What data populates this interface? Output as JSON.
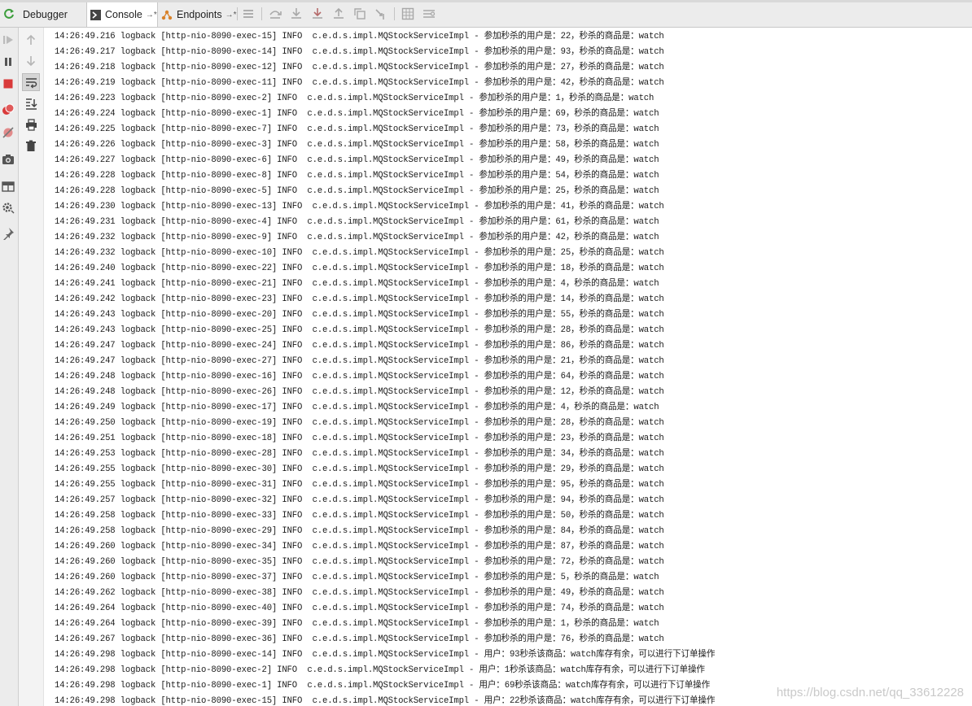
{
  "tabs": [
    {
      "label": "Debugger",
      "active": false
    },
    {
      "label": "Console",
      "active": true
    },
    {
      "label": "Endpoints",
      "active": false
    }
  ],
  "pin_glyph": "→*",
  "colors": {
    "accent_green": "#3c9e3c",
    "stop_red": "#d93a3a",
    "endpoints_orange": "#d9822b"
  },
  "console_lines": [
    "14:26:49.216 logback [http-nio-8090-exec-15] INFO  c.e.d.s.impl.MQStockServiceImpl - 参加秒杀的用户是：22，秒杀的商品是：watch",
    "14:26:49.217 logback [http-nio-8090-exec-14] INFO  c.e.d.s.impl.MQStockServiceImpl - 参加秒杀的用户是：93，秒杀的商品是：watch",
    "14:26:49.218 logback [http-nio-8090-exec-12] INFO  c.e.d.s.impl.MQStockServiceImpl - 参加秒杀的用户是：27，秒杀的商品是：watch",
    "14:26:49.219 logback [http-nio-8090-exec-11] INFO  c.e.d.s.impl.MQStockServiceImpl - 参加秒杀的用户是：42，秒杀的商品是：watch",
    "14:26:49.223 logback [http-nio-8090-exec-2] INFO  c.e.d.s.impl.MQStockServiceImpl - 参加秒杀的用户是：1，秒杀的商品是：watch",
    "14:26:49.224 logback [http-nio-8090-exec-1] INFO  c.e.d.s.impl.MQStockServiceImpl - 参加秒杀的用户是：69，秒杀的商品是：watch",
    "14:26:49.225 logback [http-nio-8090-exec-7] INFO  c.e.d.s.impl.MQStockServiceImpl - 参加秒杀的用户是：73，秒杀的商品是：watch",
    "14:26:49.226 logback [http-nio-8090-exec-3] INFO  c.e.d.s.impl.MQStockServiceImpl - 参加秒杀的用户是：58，秒杀的商品是：watch",
    "14:26:49.227 logback [http-nio-8090-exec-6] INFO  c.e.d.s.impl.MQStockServiceImpl - 参加秒杀的用户是：49，秒杀的商品是：watch",
    "14:26:49.228 logback [http-nio-8090-exec-8] INFO  c.e.d.s.impl.MQStockServiceImpl - 参加秒杀的用户是：54，秒杀的商品是：watch",
    "14:26:49.228 logback [http-nio-8090-exec-5] INFO  c.e.d.s.impl.MQStockServiceImpl - 参加秒杀的用户是：25，秒杀的商品是：watch",
    "14:26:49.230 logback [http-nio-8090-exec-13] INFO  c.e.d.s.impl.MQStockServiceImpl - 参加秒杀的用户是：41，秒杀的商品是：watch",
    "14:26:49.231 logback [http-nio-8090-exec-4] INFO  c.e.d.s.impl.MQStockServiceImpl - 参加秒杀的用户是：61，秒杀的商品是：watch",
    "14:26:49.232 logback [http-nio-8090-exec-9] INFO  c.e.d.s.impl.MQStockServiceImpl - 参加秒杀的用户是：42，秒杀的商品是：watch",
    "14:26:49.232 logback [http-nio-8090-exec-10] INFO  c.e.d.s.impl.MQStockServiceImpl - 参加秒杀的用户是：25，秒杀的商品是：watch",
    "14:26:49.240 logback [http-nio-8090-exec-22] INFO  c.e.d.s.impl.MQStockServiceImpl - 参加秒杀的用户是：18，秒杀的商品是：watch",
    "14:26:49.241 logback [http-nio-8090-exec-21] INFO  c.e.d.s.impl.MQStockServiceImpl - 参加秒杀的用户是：4，秒杀的商品是：watch",
    "14:26:49.242 logback [http-nio-8090-exec-23] INFO  c.e.d.s.impl.MQStockServiceImpl - 参加秒杀的用户是：14，秒杀的商品是：watch",
    "14:26:49.243 logback [http-nio-8090-exec-20] INFO  c.e.d.s.impl.MQStockServiceImpl - 参加秒杀的用户是：55，秒杀的商品是：watch",
    "14:26:49.243 logback [http-nio-8090-exec-25] INFO  c.e.d.s.impl.MQStockServiceImpl - 参加秒杀的用户是：28，秒杀的商品是：watch",
    "14:26:49.247 logback [http-nio-8090-exec-24] INFO  c.e.d.s.impl.MQStockServiceImpl - 参加秒杀的用户是：86，秒杀的商品是：watch",
    "14:26:49.247 logback [http-nio-8090-exec-27] INFO  c.e.d.s.impl.MQStockServiceImpl - 参加秒杀的用户是：21，秒杀的商品是：watch",
    "14:26:49.248 logback [http-nio-8090-exec-16] INFO  c.e.d.s.impl.MQStockServiceImpl - 参加秒杀的用户是：64，秒杀的商品是：watch",
    "14:26:49.248 logback [http-nio-8090-exec-26] INFO  c.e.d.s.impl.MQStockServiceImpl - 参加秒杀的用户是：12，秒杀的商品是：watch",
    "14:26:49.249 logback [http-nio-8090-exec-17] INFO  c.e.d.s.impl.MQStockServiceImpl - 参加秒杀的用户是：4，秒杀的商品是：watch",
    "14:26:49.250 logback [http-nio-8090-exec-19] INFO  c.e.d.s.impl.MQStockServiceImpl - 参加秒杀的用户是：28，秒杀的商品是：watch",
    "14:26:49.251 logback [http-nio-8090-exec-18] INFO  c.e.d.s.impl.MQStockServiceImpl - 参加秒杀的用户是：23，秒杀的商品是：watch",
    "14:26:49.253 logback [http-nio-8090-exec-28] INFO  c.e.d.s.impl.MQStockServiceImpl - 参加秒杀的用户是：34，秒杀的商品是：watch",
    "14:26:49.255 logback [http-nio-8090-exec-30] INFO  c.e.d.s.impl.MQStockServiceImpl - 参加秒杀的用户是：29，秒杀的商品是：watch",
    "14:26:49.255 logback [http-nio-8090-exec-31] INFO  c.e.d.s.impl.MQStockServiceImpl - 参加秒杀的用户是：95，秒杀的商品是：watch",
    "14:26:49.257 logback [http-nio-8090-exec-32] INFO  c.e.d.s.impl.MQStockServiceImpl - 参加秒杀的用户是：94，秒杀的商品是：watch",
    "14:26:49.258 logback [http-nio-8090-exec-33] INFO  c.e.d.s.impl.MQStockServiceImpl - 参加秒杀的用户是：50，秒杀的商品是：watch",
    "14:26:49.258 logback [http-nio-8090-exec-29] INFO  c.e.d.s.impl.MQStockServiceImpl - 参加秒杀的用户是：84，秒杀的商品是：watch",
    "14:26:49.260 logback [http-nio-8090-exec-34] INFO  c.e.d.s.impl.MQStockServiceImpl - 参加秒杀的用户是：87，秒杀的商品是：watch",
    "14:26:49.260 logback [http-nio-8090-exec-35] INFO  c.e.d.s.impl.MQStockServiceImpl - 参加秒杀的用户是：72，秒杀的商品是：watch",
    "14:26:49.260 logback [http-nio-8090-exec-37] INFO  c.e.d.s.impl.MQStockServiceImpl - 参加秒杀的用户是：5，秒杀的商品是：watch",
    "14:26:49.262 logback [http-nio-8090-exec-38] INFO  c.e.d.s.impl.MQStockServiceImpl - 参加秒杀的用户是：49，秒杀的商品是：watch",
    "14:26:49.264 logback [http-nio-8090-exec-40] INFO  c.e.d.s.impl.MQStockServiceImpl - 参加秒杀的用户是：74，秒杀的商品是：watch",
    "14:26:49.264 logback [http-nio-8090-exec-39] INFO  c.e.d.s.impl.MQStockServiceImpl - 参加秒杀的用户是：1，秒杀的商品是：watch",
    "14:26:49.267 logback [http-nio-8090-exec-36] INFO  c.e.d.s.impl.MQStockServiceImpl - 参加秒杀的用户是：76，秒杀的商品是：watch",
    "14:26:49.298 logback [http-nio-8090-exec-14] INFO  c.e.d.s.impl.MQStockServiceImpl - 用户：93秒杀该商品：watch库存有余，可以进行下订单操作",
    "14:26:49.298 logback [http-nio-8090-exec-2] INFO  c.e.d.s.impl.MQStockServiceImpl - 用户：1秒杀该商品：watch库存有余，可以进行下订单操作",
    "14:26:49.298 logback [http-nio-8090-exec-1] INFO  c.e.d.s.impl.MQStockServiceImpl - 用户：69秒杀该商品：watch库存有余，可以进行下订单操作",
    "14:26:49.298 logback [http-nio-8090-exec-15] INFO  c.e.d.s.impl.MQStockServiceImpl - 用户：22秒杀该商品：watch库存有余，可以进行下订单操作"
  ],
  "watermark": "https://blog.csdn.net/qq_33612228"
}
